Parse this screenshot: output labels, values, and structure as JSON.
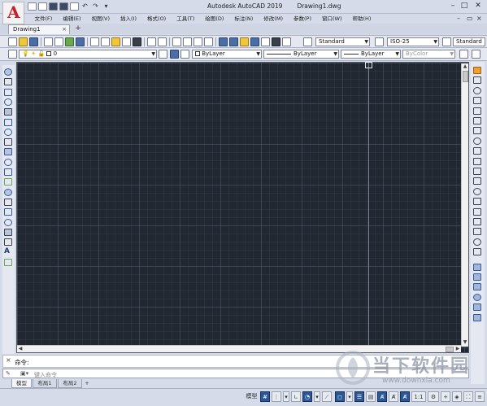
{
  "app": {
    "title": "Autodesk AutoCAD 2019",
    "filename": "Drawing1.dwg",
    "logo_letter": "A"
  },
  "menu": {
    "items": [
      "文件(F)",
      "编辑(E)",
      "视图(V)",
      "插入(I)",
      "格式(O)",
      "工具(T)",
      "绘图(D)",
      "标注(N)",
      "修改(M)",
      "参数(P)",
      "窗口(W)",
      "帮助(H)"
    ]
  },
  "tabs": {
    "doc_tab": "Drawing1",
    "close_glyph": "×",
    "new_tab_glyph": "+"
  },
  "toolbar": {
    "text_style": "Standard",
    "dim_style": "ISO-25",
    "table_style": "Standard",
    "layer_name": "0",
    "color": "ByLayer",
    "linetype": "ByLayer",
    "lineweight": "ByLayer",
    "plot_style": "ByColor"
  },
  "command": {
    "history_label": "命令:",
    "placeholder": "键入命令",
    "close_glyph": "×"
  },
  "layout_tabs": [
    "模型",
    "布局1",
    "布局2"
  ],
  "layout_add": "+",
  "status": {
    "model_label": "模型",
    "scale": "1:1"
  },
  "watermark": {
    "name": "当下软件园",
    "url": "www.downxia.com"
  },
  "colors": {
    "canvas_bg": "#212832",
    "accent": "#c8202a",
    "status_active": "#2b5797"
  }
}
